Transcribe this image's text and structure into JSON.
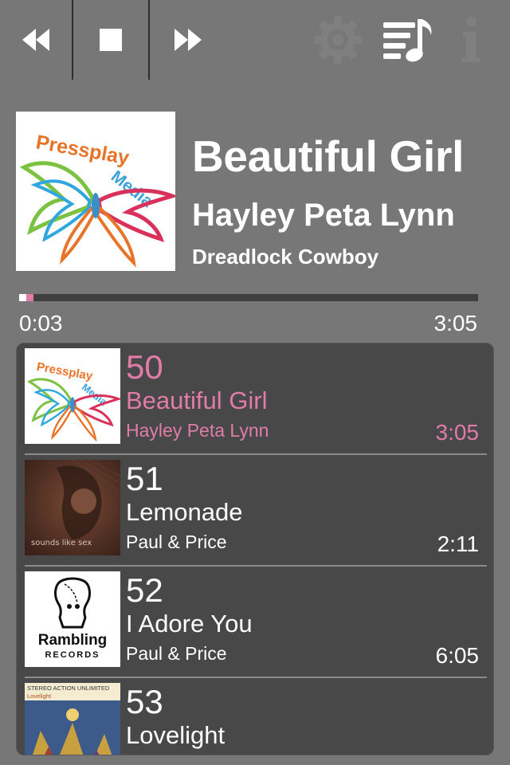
{
  "toolbar": {
    "buttons": [
      {
        "name": "rewind",
        "icon": "rewind-icon"
      },
      {
        "name": "stop",
        "icon": "stop-icon"
      },
      {
        "name": "fast-forward",
        "icon": "fast-forward-icon"
      },
      {
        "name": "settings",
        "icon": "gear-icon"
      },
      {
        "name": "playlist",
        "icon": "playlist-music-icon"
      },
      {
        "name": "info",
        "icon": "info-icon"
      }
    ]
  },
  "now_playing": {
    "title": "Beautiful Girl",
    "artist": "Hayley Peta Lynn",
    "album": "Dreadlock Cowboy",
    "artwork": {
      "line1": "Pressplay",
      "line2": "Media"
    },
    "elapsed": "0:03",
    "total": "3:05",
    "progress_fraction": 0.016
  },
  "playlist": {
    "tracks": [
      {
        "number": "50",
        "title": "Beautiful Girl",
        "artist": "Hayley Peta Lynn",
        "duration": "3:05",
        "active": true,
        "art": "pressplay"
      },
      {
        "number": "51",
        "title": "Lemonade",
        "artist": "Paul & Price",
        "duration": "2:11",
        "active": false,
        "art": "sounds",
        "art_text": "sounds like sex"
      },
      {
        "number": "52",
        "title": "I Adore You",
        "artist": "Paul & Price",
        "duration": "6:05",
        "active": false,
        "art": "rambling",
        "art_text": "Rambling",
        "art_sub": "RECORDS"
      },
      {
        "number": "53",
        "title": "Lovelight",
        "artist": "",
        "duration": "",
        "active": false,
        "art": "stereo",
        "art_text": "STEREO ACTION UNLIMITED",
        "art_sub": "Lovelight"
      }
    ]
  },
  "colors": {
    "background": "#777777",
    "accent": "#e07ca6",
    "panel": "#484848",
    "track_bar": "#3f3f3f"
  }
}
